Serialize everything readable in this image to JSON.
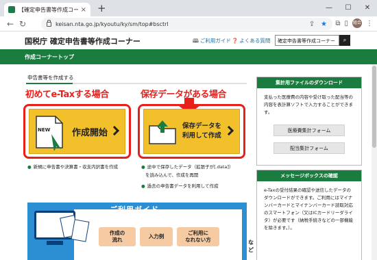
{
  "browser": {
    "tab_title": "【確定申告書等作成コーナー】-作成",
    "tab_close": "×",
    "new_tab": "+",
    "win_min": "—",
    "win_max": "☐",
    "win_close": "✕",
    "url": "keisan.nta.go.jp/kyoutu/ky/sm/top#bsctrl",
    "profile_initials": "組合"
  },
  "header": {
    "site_title": "国税庁 確定申告書等作成コーナー",
    "guide_link": "ご利用ガイド",
    "faq_link": "よくある質問",
    "search_value": "確定申告書等作成コーナー"
  },
  "greenbar": {
    "title": "作成コーナートップ"
  },
  "main": {
    "section_title": "申告書等を作成する",
    "annot_left": "初めてe-Taxする場合",
    "annot_right": "保存データがある場合",
    "create_btn": {
      "badge": "NEW",
      "label": "作成開始"
    },
    "resume_btn": {
      "label_line1": "保存データを",
      "label_line2": "利用して作成"
    },
    "bullets_left": [
      "新規に申告書や決算書・収支内訳書を作成"
    ],
    "bullets_right": [
      "途中で保存したデータ（拡張子が[.data]）",
      "を読み込んで、作成を再開",
      "過去の申告書データを利用して作成"
    ]
  },
  "guide": {
    "title": "ご利用ガイド",
    "chip1": [
      "作成の",
      "流れ"
    ],
    "chip2": "入力例",
    "chip3": [
      "ご利用に",
      "なれない方"
    ],
    "suffix": "など"
  },
  "sidebar": {
    "download": {
      "title": "集計用ファイルのダウンロード",
      "text": "支払った医療費の内容や受け取った配当等の内容を表計算ソフトで入力することができます。",
      "btn1": "医療費集計フォーム",
      "btn2": "配当集計フォーム"
    },
    "message": {
      "title": "メッセージボックスの確認",
      "text": "e-Taxの受付結果の確認や送信したデータのダウンロードができます。ご利用にはマイナンバーカードとマイナンバーカード読取対応のスマートフォン（又はICカードリーダライタ）が必要です（納税手続きなどの一部機能を除きます。）。"
    }
  },
  "colors": {
    "green": "#1a7d3f",
    "yellow_button": "#f2c02b",
    "annotation_red": "#e8201c",
    "guide_blue": "#2c8fd4"
  }
}
